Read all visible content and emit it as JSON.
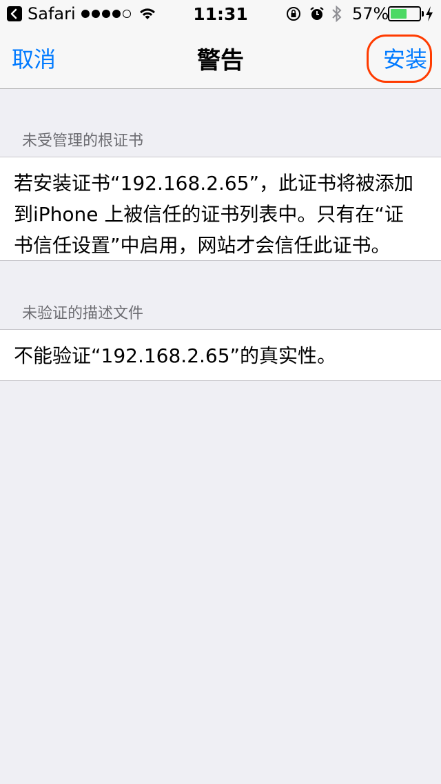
{
  "status_bar": {
    "back_app": "Safari",
    "time": "11:31",
    "battery_percent": "57%",
    "battery_level": 0.57,
    "icons": [
      "back-arrow-icon",
      "signal-dots-icon",
      "wifi-icon",
      "rotation-lock-icon",
      "alarm-icon",
      "bluetooth-icon",
      "battery-icon",
      "charging-bolt-icon"
    ]
  },
  "nav": {
    "cancel": "取消",
    "title": "警告",
    "install": "安装"
  },
  "sections": [
    {
      "header": "未受管理的根证书",
      "body": "若安装证书“192.168.2.65”，此证书将被添加到iPhone 上被信任的证书列表中。只有在“证书信任设置”中启用，网站才会信任此证书。"
    },
    {
      "header": "未验证的描述文件",
      "body": "不能验证“192.168.2.65”的真实性。"
    }
  ],
  "colors": {
    "accent": "#007aff",
    "highlight": "#ff3b00",
    "battery": "#4cd964",
    "background": "#efeff4"
  }
}
